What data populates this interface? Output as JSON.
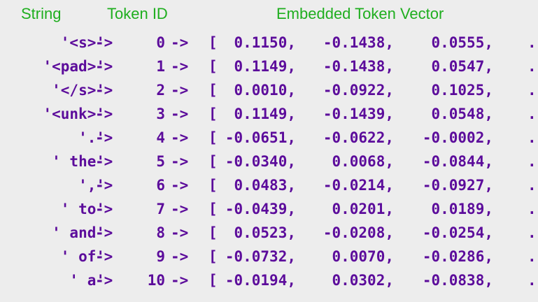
{
  "headers": {
    "string": "String",
    "token_id": "Token ID",
    "vector": "Embedded Token Vector"
  },
  "arrow": "->",
  "bracket": "[",
  "ellipsis": ".",
  "rows": [
    {
      "string": "'<s>'",
      "token_id": "0",
      "v1": "0.1150,",
      "v2": "-0.1438,",
      "v3": "0.0555,"
    },
    {
      "string": "'<pad>'",
      "token_id": "1",
      "v1": "0.1149,",
      "v2": "-0.1438,",
      "v3": "0.0547,"
    },
    {
      "string": "'</s>'",
      "token_id": "2",
      "v1": "0.0010,",
      "v2": "-0.0922,",
      "v3": "0.1025,"
    },
    {
      "string": "'<unk>'",
      "token_id": "3",
      "v1": "0.1149,",
      "v2": "-0.1439,",
      "v3": "0.0548,"
    },
    {
      "string": "'.'",
      "token_id": "4",
      "v1": "-0.0651,",
      "v2": "-0.0622,",
      "v3": "-0.0002,"
    },
    {
      "string": "' the'",
      "token_id": "5",
      "v1": "-0.0340,",
      "v2": "0.0068,",
      "v3": "-0.0844,"
    },
    {
      "string": "','",
      "token_id": "6",
      "v1": "0.0483,",
      "v2": "-0.0214,",
      "v3": "-0.0927,"
    },
    {
      "string": "' to'",
      "token_id": "7",
      "v1": "-0.0439,",
      "v2": "0.0201,",
      "v3": "0.0189,"
    },
    {
      "string": "' and'",
      "token_id": "8",
      "v1": "0.0523,",
      "v2": "-0.0208,",
      "v3": "-0.0254,"
    },
    {
      "string": "' of'",
      "token_id": "9",
      "v1": "-0.0732,",
      "v2": "0.0070,",
      "v3": "-0.0286,"
    },
    {
      "string": "' a'",
      "token_id": "10",
      "v1": "-0.0194,",
      "v2": "0.0302,",
      "v3": "-0.0838,"
    }
  ]
}
